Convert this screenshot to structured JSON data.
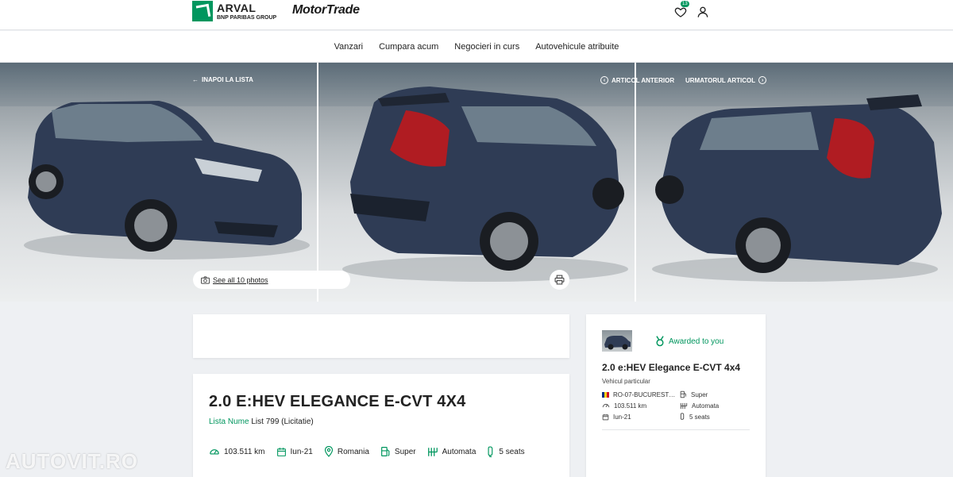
{
  "header": {
    "brand_primary": "ARVAL",
    "brand_sub": "BNP PARIBAS GROUP",
    "brand_secondary": "MotorTrade",
    "favorites_count": "13",
    "accent_color": "#00965e"
  },
  "nav": {
    "items": [
      "Vanzari",
      "Cumpara acum",
      "Negocieri in curs",
      "Autovehicule atribuite"
    ]
  },
  "gallery": {
    "back_label": "INAPOI LA LISTA",
    "prev_label": "ARTICOL ANTERIOR",
    "next_label": "URMATORUL ARTICOL",
    "photos_label": "See all 10 photos"
  },
  "listing": {
    "title": "2.0 E:HEV ELEGANCE E-CVT 4X4",
    "list_label": "Lista Nume",
    "list_value": "List 799 (Licitatie)",
    "specs": {
      "mileage": "103.511 km",
      "date": "Iun-21",
      "country": "Romania",
      "fuel": "Super",
      "transmission": "Automata",
      "seats": "5 seats"
    }
  },
  "side": {
    "awarded": "Awarded to you",
    "title": "2.0 e:HEV Elegance E-CVT 4x4",
    "subtitle": "Vehicul particular",
    "location": "RO-07-BUCUREST…",
    "fuel": "Super",
    "mileage": "103.511 km",
    "transmission": "Automata",
    "date": "Iun-21",
    "seats": "5 seats"
  },
  "watermark": "AUTOVIT.RO"
}
